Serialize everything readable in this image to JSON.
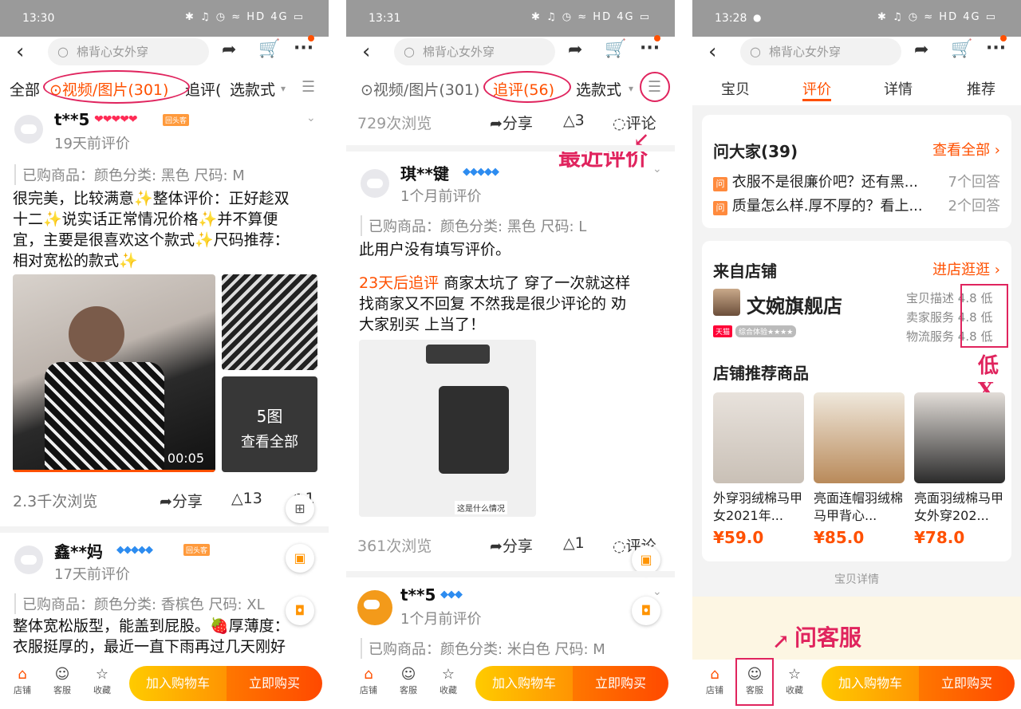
{
  "panel1": {
    "status_time": "13:30",
    "status_icons": "✱ ♫ ◷ ≈ HD 4G ▭",
    "search_placeholder": "棉背心女外穿",
    "filters": {
      "all": "全部",
      "video": "⊙视频/图片(301)",
      "followup": "追评(",
      "style": "选款式",
      "style_arrow": "▾",
      "filter_icon": "☰"
    },
    "review1": {
      "name": "t**5",
      "hearts": "❤❤❤❤❤",
      "badge": "回头客",
      "date": "19天前评价",
      "sku": "已购商品：颜色分类: 黑色   尺码: M",
      "text": [
        "很完美，比较满意✨整体评价：正好趁双",
        "十二✨说实话正常情况价格✨并不算便",
        "宜，主要是很喜欢这个款式✨尺码推荐：",
        "相对宽松的款式✨"
      ],
      "video_time": "00:05",
      "more_count": "5图",
      "more_label": "查看全部",
      "views": "2.3千次浏览",
      "share": "分享",
      "likes": "13",
      "comments": "1"
    },
    "review2": {
      "name": "鑫**妈",
      "diamonds": "◆◆◆◆◆",
      "badge": "回头客",
      "date": "17天前评价",
      "sku": "已购商品：颜色分类: 香槟色   尺码: XL",
      "text": [
        "整体宽松版型，能盖到屁股。🍓厚薄度：",
        "衣服挺厚的，最近一直下雨再过几天刚好"
      ]
    }
  },
  "panel2": {
    "status_time": "13:31",
    "status_icons": "✱ ♫ ◷ ≈ HD 4G ▭",
    "search_placeholder": "棉背心女外穿",
    "filters": {
      "video": "⊙视频/图片(301)",
      "followup": "追评(56)",
      "style": "选款式",
      "style_arrow": "▾",
      "filter_icon": "☰"
    },
    "top_stats": {
      "views": "729次浏览",
      "share": "分享",
      "likes": "3",
      "comment": "评论"
    },
    "annotation": "最近评价",
    "review1": {
      "name": "琪**键",
      "diamonds": "◆◆◆◆◆",
      "date": "1个月前评价",
      "sku": "已购商品：颜色分类: 黑色   尺码: L",
      "text": "此用户没有填写评价。",
      "followup_label": "23天后追评",
      "followup_text": [
        "商家太坑了 穿了一次就这样",
        "找商家又不回复 不然我是很少评论的 劝",
        "大家别买 上当了！"
      ],
      "img_caption": "这是什么情况",
      "views": "361次浏览",
      "share": "分享",
      "likes": "1",
      "comment": "评论"
    },
    "review2": {
      "name": "t**5",
      "diamonds": "◆◆◆",
      "date": "1个月前评价",
      "sku": "已购商品：颜色分类: 米白色   尺码: M"
    }
  },
  "panel3": {
    "status_time": "13:28",
    "status_icons": "✱ ♫ ◷ ≈ HD 4G ▭",
    "search_placeholder": "棉背心女外穿",
    "tabs": [
      "宝贝",
      "评价",
      "详情",
      "推荐"
    ],
    "qa": {
      "title": "问大家(39)",
      "link": "查看全部 ›",
      "items": [
        {
          "q": "衣服不是很廉价吧？还有黑...",
          "a": "7个回答"
        },
        {
          "q": "质量怎么样.厚不厚的？看上...",
          "a": "2个回答"
        }
      ]
    },
    "store": {
      "title": "来自店铺",
      "link": "进店逛逛 ›",
      "name": "文婉旗舰店",
      "tmall": "天猫",
      "experience": "综合体验★★★★",
      "ratings": [
        {
          "label": "宝贝描述",
          "score": "4.8",
          "level": "低"
        },
        {
          "label": "卖家服务",
          "score": "4.8",
          "level": "低"
        },
        {
          "label": "物流服务",
          "score": "4.8",
          "level": "低"
        }
      ]
    },
    "low_annotation": "低X",
    "rec_title": "店铺推荐商品",
    "products": [
      {
        "name": "外穿羽绒棉马甲女2021年...",
        "price": "¥59.0"
      },
      {
        "name": "亮面连帽羽绒棉马甲背心...",
        "price": "¥85.0"
      },
      {
        "name": "亮面羽绒棉马甲女外穿202...",
        "price": "¥78.0"
      }
    ],
    "detail_divider": "宝贝详情",
    "cs_annotation": "问客服"
  },
  "bottom": {
    "shop": "店铺",
    "service": "客服",
    "fav": "收藏",
    "cart": "加入购物车",
    "buy": "立即购买"
  },
  "colors": {
    "accent": "#ff5000",
    "annotation": "#e0245e"
  }
}
